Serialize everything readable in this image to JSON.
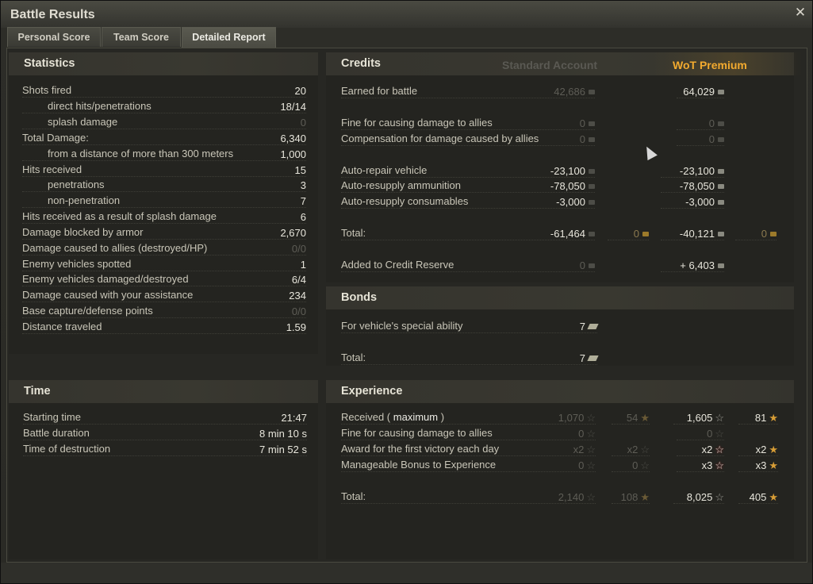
{
  "window": {
    "title": "Battle Results"
  },
  "tabs": [
    {
      "label": "Personal Score"
    },
    {
      "label": "Team Score"
    },
    {
      "label": "Detailed Report"
    }
  ],
  "statistics": {
    "title": "Statistics",
    "rows": [
      {
        "label": "Shots fired",
        "value": "20"
      },
      {
        "label": "direct hits/penetrations",
        "value": "18/14"
      },
      {
        "label": "splash damage",
        "value": "0"
      },
      {
        "label": "Total Damage:",
        "value": "6,340"
      },
      {
        "label": "from a distance of more than 300 meters",
        "value": "1,000"
      },
      {
        "label": "Hits received",
        "value": "15"
      },
      {
        "label": "penetrations",
        "value": "3"
      },
      {
        "label": "non-penetration",
        "value": "7"
      },
      {
        "label": "Hits received as a result of splash damage",
        "value": "6"
      },
      {
        "label": "Damage blocked by armor",
        "value": "2,670"
      },
      {
        "label": "Damage caused to allies (destroyed/HP)",
        "value": "0/0"
      },
      {
        "label": "Enemy vehicles spotted",
        "value": "1"
      },
      {
        "label": "Enemy vehicles damaged/destroyed",
        "value": "6/4"
      },
      {
        "label": "Damage caused with your assistance",
        "value": "234"
      },
      {
        "label": "Base capture/defense points",
        "value": "0/0"
      },
      {
        "label": "Distance traveled",
        "value": "1.59"
      }
    ]
  },
  "time": {
    "title": "Time",
    "rows": [
      {
        "label": "Starting time",
        "value": "21:47"
      },
      {
        "label": "Battle duration",
        "value": "8 min 10 s"
      },
      {
        "label": "Time of destruction",
        "value": "7 min 52 s"
      }
    ]
  },
  "credits": {
    "title": "Credits",
    "standard_head": "Standard Account",
    "premium_head": "WoT Premium",
    "rows": [
      {
        "label": "Earned for battle",
        "std": "42,686",
        "prem": "64,029"
      },
      {
        "label": "Fine for causing damage to allies",
        "std": "0",
        "prem": "0"
      },
      {
        "label": "Compensation for damage caused by allies",
        "std": "0",
        "prem": "0"
      },
      {
        "label": "Auto-repair vehicle",
        "std": "-23,100",
        "prem": "-23,100"
      },
      {
        "label": "Auto-resupply ammunition",
        "std": "-78,050",
        "prem": "-78,050"
      },
      {
        "label": "Auto-resupply consumables",
        "std": "-3,000",
        "prem": "-3,000"
      },
      {
        "label": "Total:",
        "std": "-61,464",
        "std_gold": "0",
        "prem": "-40,121",
        "prem_gold": "0"
      },
      {
        "label": "Added to Credit Reserve",
        "std": "0",
        "prem": "+ 6,403"
      }
    ]
  },
  "bonds": {
    "title": "Bonds",
    "rows": [
      {
        "label": "For vehicle's special ability",
        "value": "7"
      },
      {
        "label": "Total:",
        "value": "7"
      }
    ]
  },
  "experience": {
    "title": "Experience",
    "received_label": "Received (",
    "received_link": "maximum",
    "received_close": ")",
    "rows": [
      {
        "label": "Received",
        "std_xp": "1,070",
        "std_fxp": "54",
        "prem_xp": "1,605",
        "prem_fxp": "81"
      },
      {
        "label": "Fine for causing damage to allies",
        "std_xp": "0",
        "prem_xp": "0"
      },
      {
        "label": "Award for the first victory each day",
        "std_xp": "x2",
        "std_fxp": "x2",
        "prem_xp": "x2",
        "prem_fxp": "x2"
      },
      {
        "label": "Manageable Bonus to Experience",
        "std_xp": "0",
        "std_fxp": "0",
        "prem_xp": "x3",
        "prem_fxp": "x3"
      },
      {
        "label": "Total:",
        "std_xp": "2,140",
        "std_fxp": "108",
        "prem_xp": "8,025",
        "prem_fxp": "405"
      }
    ]
  },
  "icons": {
    "close": "close-icon",
    "credit": "credit-icon",
    "gold": "gold-icon",
    "bond": "bond-icon",
    "xp_star": "xp-star-icon",
    "free_xp_star": "free-xp-star-icon"
  },
  "colors": {
    "negative": "#e2201b",
    "premium": "#f2aa2f",
    "free_xp_star": "#d79d36"
  }
}
